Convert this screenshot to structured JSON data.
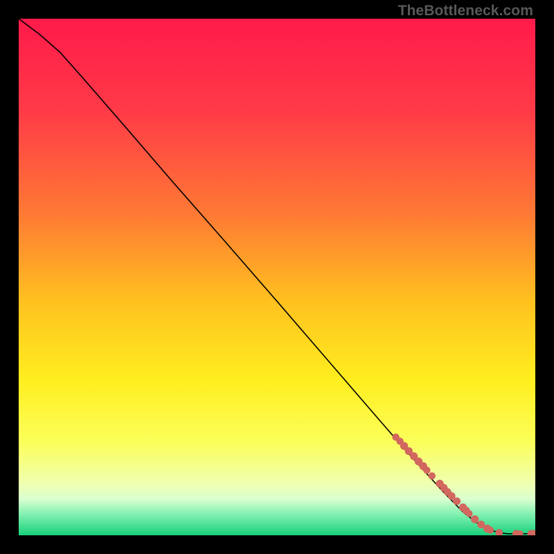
{
  "attribution": "TheBottleneck.com",
  "chart_data": {
    "type": "line",
    "title": "",
    "xlabel": "",
    "ylabel": "",
    "xlim": [
      0,
      100
    ],
    "ylim": [
      0,
      100
    ],
    "background_gradient": {
      "stops": [
        {
          "offset": 0,
          "color": "#ff1a4a"
        },
        {
          "offset": 18,
          "color": "#ff3b47"
        },
        {
          "offset": 38,
          "color": "#ff7a34"
        },
        {
          "offset": 55,
          "color": "#ffc21f"
        },
        {
          "offset": 70,
          "color": "#ffee1f"
        },
        {
          "offset": 82,
          "color": "#fbff5a"
        },
        {
          "offset": 90,
          "color": "#f0ffb0"
        },
        {
          "offset": 93,
          "color": "#daffd0"
        },
        {
          "offset": 96,
          "color": "#7ff0b0"
        },
        {
          "offset": 100,
          "color": "#18d07a"
        }
      ]
    },
    "curve": {
      "x": [
        0,
        4,
        8,
        12,
        20,
        30,
        40,
        50,
        60,
        70,
        74,
        78,
        82,
        86,
        89,
        91,
        93,
        94.5,
        96.5,
        98.5,
        100
      ],
      "y": [
        100,
        97,
        93.5,
        89,
        79.8,
        68.2,
        56.8,
        45.3,
        33.7,
        22.1,
        17.5,
        13.0,
        8.6,
        4.5,
        2.2,
        1.1,
        0.5,
        0.3,
        0.3,
        0.3,
        0.3
      ]
    },
    "markers": [
      {
        "x": 73.0,
        "y": 19.0,
        "r": 5.2
      },
      {
        "x": 73.8,
        "y": 18.2,
        "r": 5.2
      },
      {
        "x": 74.6,
        "y": 17.3,
        "r": 5.7
      },
      {
        "x": 75.5,
        "y": 16.3,
        "r": 5.7
      },
      {
        "x": 76.5,
        "y": 15.3,
        "r": 5.7
      },
      {
        "x": 77.4,
        "y": 14.3,
        "r": 5.7
      },
      {
        "x": 78.3,
        "y": 13.4,
        "r": 5.7
      },
      {
        "x": 79.0,
        "y": 12.6,
        "r": 5.2
      },
      {
        "x": 80.0,
        "y": 11.5,
        "r": 5.2
      },
      {
        "x": 81.5,
        "y": 10.0,
        "r": 5.7
      },
      {
        "x": 82.3,
        "y": 9.2,
        "r": 5.5
      },
      {
        "x": 83.0,
        "y": 8.4,
        "r": 5.5
      },
      {
        "x": 83.8,
        "y": 7.6,
        "r": 5.5
      },
      {
        "x": 84.8,
        "y": 6.6,
        "r": 5.5
      },
      {
        "x": 86.0,
        "y": 5.4,
        "r": 5.7
      },
      {
        "x": 86.6,
        "y": 4.8,
        "r": 5.5
      },
      {
        "x": 87.2,
        "y": 4.2,
        "r": 5.0
      },
      {
        "x": 88.3,
        "y": 3.1,
        "r": 5.7
      },
      {
        "x": 89.5,
        "y": 2.1,
        "r": 5.5
      },
      {
        "x": 90.7,
        "y": 1.3,
        "r": 5.7
      },
      {
        "x": 91.3,
        "y": 1.0,
        "r": 5.0
      },
      {
        "x": 93.0,
        "y": 0.5,
        "r": 5.3
      },
      {
        "x": 96.3,
        "y": 0.3,
        "r": 5.5
      },
      {
        "x": 97.0,
        "y": 0.3,
        "r": 5.0
      },
      {
        "x": 99.2,
        "y": 0.3,
        "r": 5.5
      },
      {
        "x": 99.9,
        "y": 0.3,
        "r": 5.5
      }
    ],
    "marker_color": "#d1675e"
  }
}
